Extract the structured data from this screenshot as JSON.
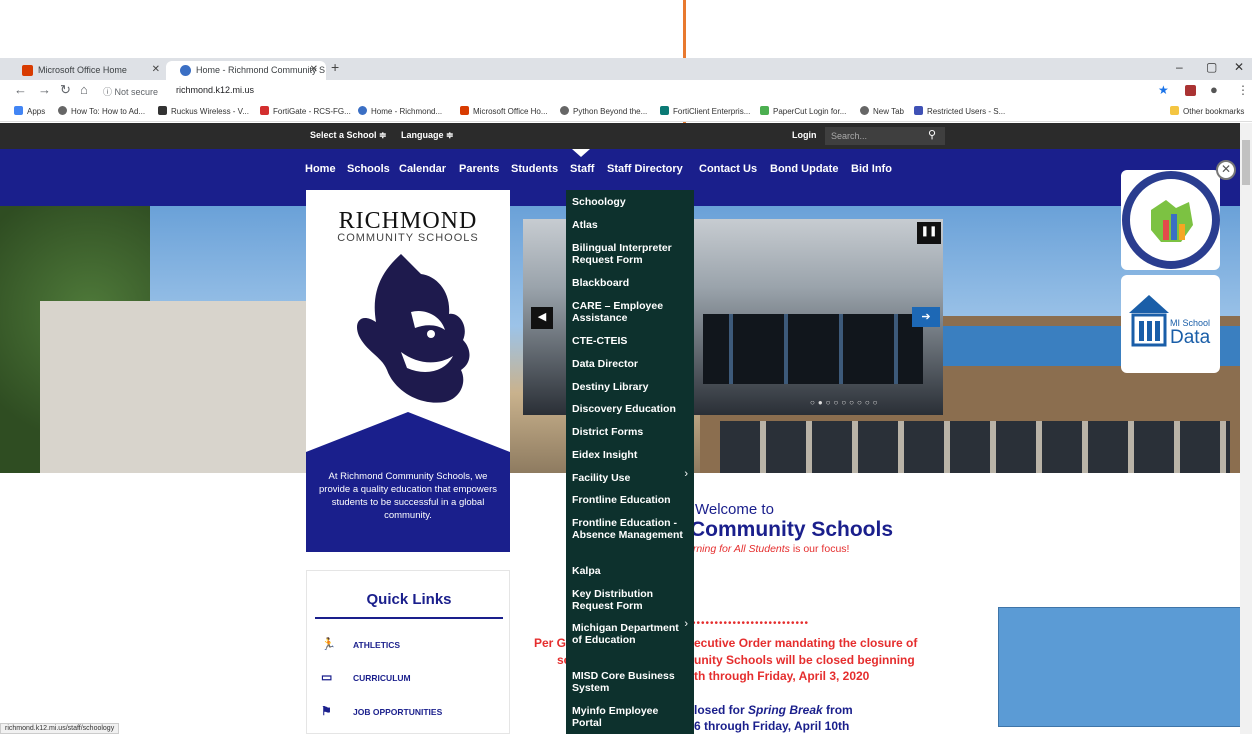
{
  "browser": {
    "tabs": [
      {
        "label": "Microsoft Office Home",
        "favicon_color": "#d83b01"
      },
      {
        "label": "Home - Richmond Community S",
        "favicon_color": "#3b6fc4"
      }
    ],
    "address": {
      "security": "Not secure",
      "url": "richmond.k12.mi.us"
    },
    "bookmarks": [
      "Apps",
      "How To: How to Ad...",
      "Ruckus Wireless - V...",
      "FortiGate - RCS-FG...",
      "Home - Richmond...",
      "Microsoft Office Ho...",
      "Python Beyond the...",
      "FortiClient Enterpris...",
      "PaperCut Login for...",
      "New Tab",
      "Restricted Users - S..."
    ],
    "other_bookmarks": "Other bookmarks",
    "status_url": "richmond.k12.mi.us/staff/schoology"
  },
  "topbar": {
    "select_school": "Select a School ≑",
    "language": "Language ≑",
    "login": "Login",
    "search_placeholder": "Search..."
  },
  "nav": [
    "Home",
    "Schools",
    "Calendar",
    "Parents",
    "Students",
    "Staff",
    "Staff Directory",
    "Contact Us",
    "Bond Update",
    "Bid Info"
  ],
  "logo": {
    "title": "RICHMOND",
    "subtitle": "COMMUNITY SCHOOLS",
    "mission": "At Richmond Community Schools, we provide a quality education that empowers students to be successful in a global community."
  },
  "quick_links": {
    "title": "Quick Links",
    "items": [
      "ATHLETICS",
      "CURRICULUM",
      "JOB OPPORTUNITIES"
    ]
  },
  "welcome": {
    "line1": "Welcome to",
    "line2": "Community Schools",
    "line3_italic": "arning for All Students",
    "line3_rest": " is our focus!"
  },
  "notices": {
    "n1a": "Per G",
    "n1b": "ecutive Order mandating the closure of",
    "n2a": "sch",
    "n2b": "unity Schools will be closed beginning",
    "n3": "th through Friday, April 3, 2020",
    "n4a": "losed for ",
    "n4b": "Spring Break",
    "n4c": " from",
    "n5": "6 through Friday, April 10th"
  },
  "dropdown": [
    {
      "label": "Schoology"
    },
    {
      "label": "Atlas"
    },
    {
      "label": "Bilingual Interpreter Request Form"
    },
    {
      "label": "Blackboard"
    },
    {
      "label": "CARE – Employee Assistance"
    },
    {
      "label": "CTE-CTEIS"
    },
    {
      "label": "Data Director"
    },
    {
      "label": "Destiny Library"
    },
    {
      "label": "Discovery Education"
    },
    {
      "label": "District Forms"
    },
    {
      "label": "Eidex Insight"
    },
    {
      "label": "Facility Use"
    },
    {
      "label": "Frontline Education"
    },
    {
      "label": "Frontline Education - Absence Management"
    },
    {
      "label": "Kalpa"
    },
    {
      "label": "Key Distribution Request Form"
    },
    {
      "label": "Michigan Department of Education"
    },
    {
      "label": "MISD Core Business System"
    },
    {
      "label": "Myinfo Employee Portal"
    }
  ],
  "widgets": {
    "mischool_small": "MI School",
    "mischool_big": "Data"
  },
  "colors": {
    "nav_blue": "#1a1f8c",
    "dropdown_bg": "#0d312d",
    "notice_red": "#e52e2e",
    "arrow_orange": "#e8792f"
  }
}
